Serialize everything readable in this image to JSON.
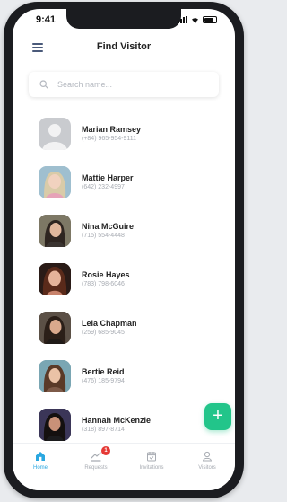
{
  "status_bar": {
    "time": "9:41"
  },
  "header": {
    "title": "Find Visitor",
    "menu_icon": "hamburger-icon"
  },
  "search": {
    "placeholder": "Search name...",
    "icon": "search-icon"
  },
  "visitors": [
    {
      "name": "Marian Ramsey",
      "phone": "(+84) 965-954-9111",
      "avatar": "placeholder"
    },
    {
      "name": "Mattie Harper",
      "phone": "(642) 232-4997",
      "avatar": "photo"
    },
    {
      "name": "Nina McGuire",
      "phone": "(715) 554-4448",
      "avatar": "photo"
    },
    {
      "name": "Rosie Hayes",
      "phone": "(783) 798-6046",
      "avatar": "photo"
    },
    {
      "name": "Lela Chapman",
      "phone": "(259) 685-9045",
      "avatar": "photo"
    },
    {
      "name": "Bertie Reid",
      "phone": "(476) 185-9794",
      "avatar": "photo"
    },
    {
      "name": "Hannah McKenzie",
      "phone": "(318) 897-8714",
      "avatar": "photo"
    }
  ],
  "fab": {
    "label": "+",
    "icon": "plus-icon"
  },
  "tabs": [
    {
      "label": "Home",
      "icon": "home-icon",
      "active": true
    },
    {
      "label": "Requests",
      "icon": "requests-icon",
      "badge": "1"
    },
    {
      "label": "Invitations",
      "icon": "calendar-icon"
    },
    {
      "label": "Visitors",
      "icon": "user-icon"
    }
  ],
  "colors": {
    "accent": "#2aa7e0",
    "fab": "#22c58a",
    "badge": "#e53935",
    "menu": "#4a5a7a"
  }
}
